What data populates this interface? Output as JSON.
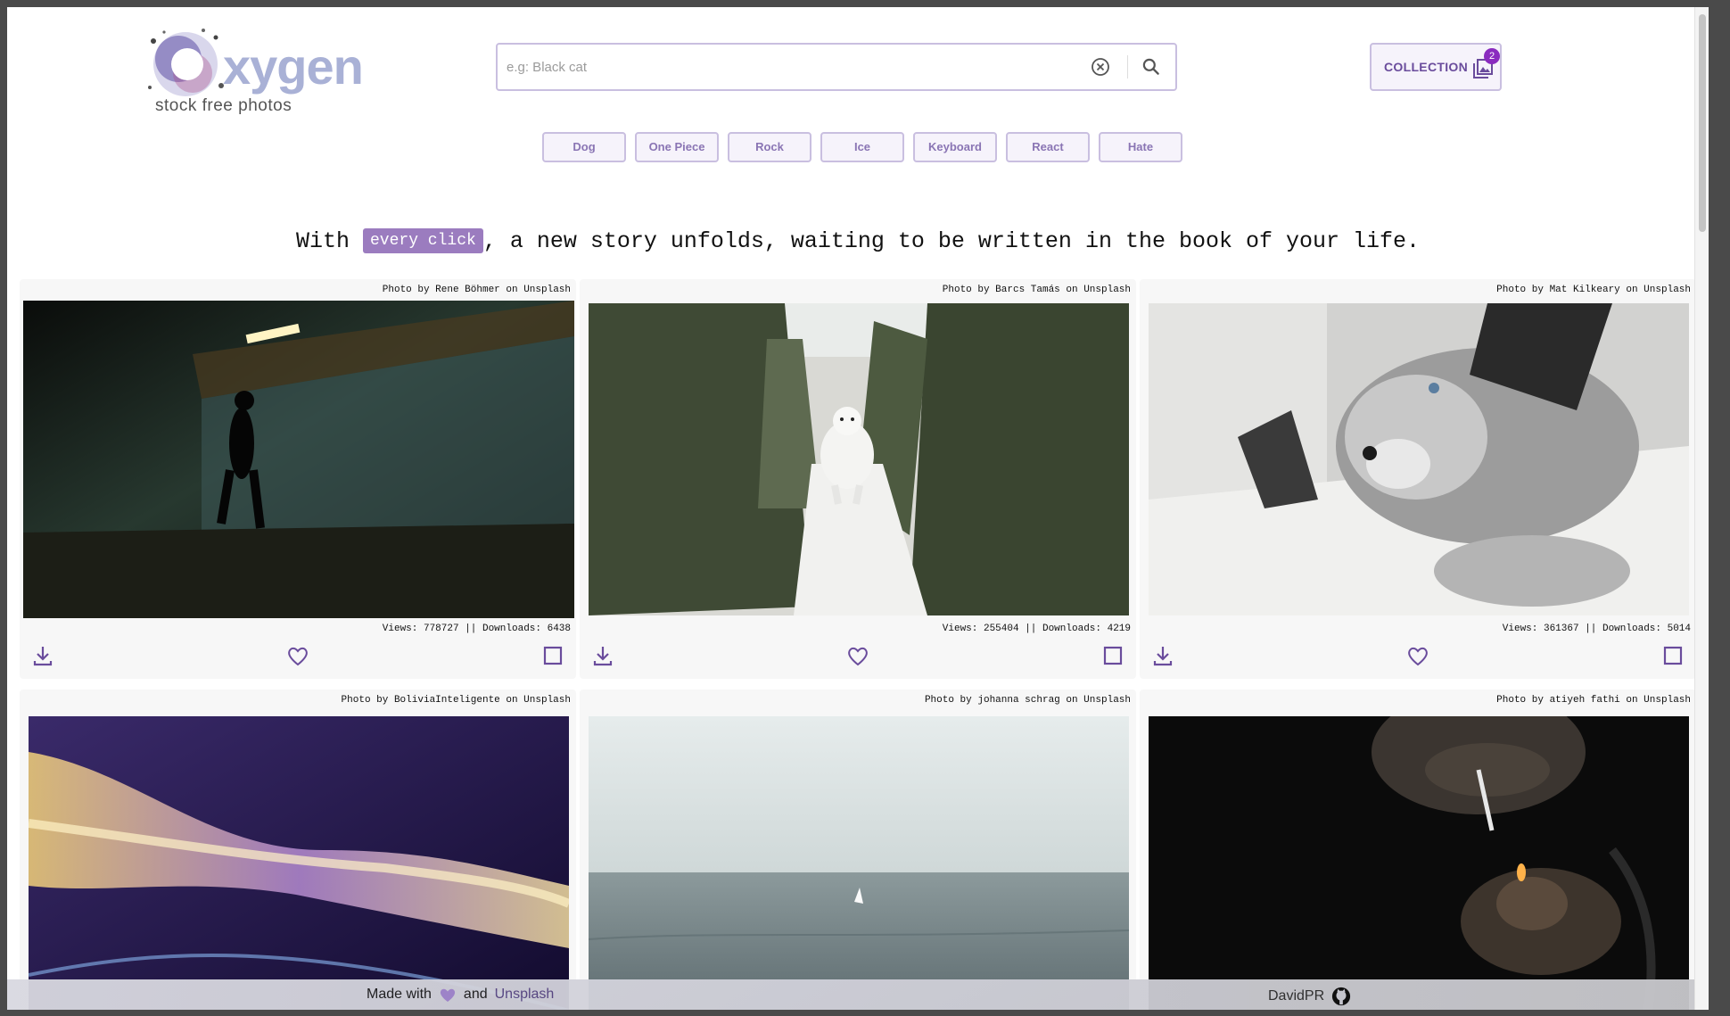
{
  "header": {
    "logo_word": "xygen",
    "logo_subtitle": "stock free photos",
    "search": {
      "placeholder": "e.g: Black cat",
      "value": "",
      "clear_icon": "clear-circle-icon",
      "search_icon": "search-icon"
    },
    "collection": {
      "label": "COLLECTION",
      "count": "2",
      "icon": "photo-library-icon"
    }
  },
  "tags": [
    "Dog",
    "One Piece",
    "Rock",
    "Ice",
    "Keyboard",
    "React",
    "Hate"
  ],
  "tagline": {
    "before": "With ",
    "highlight": "every click",
    "after": ", a new story unfolds, waiting to be written in the book of your life."
  },
  "photos": [
    {
      "credit": "Photo by Rene Böhmer on Unsplash",
      "stats": "Views: 778727 || Downloads: 6438"
    },
    {
      "credit": "Photo by Barcs Tamás on Unsplash",
      "stats": "Views: 255404 || Downloads: 4219"
    },
    {
      "credit": "Photo by Mat Kilkeary on Unsplash",
      "stats": "Views: 361367 || Downloads: 5014"
    },
    {
      "credit": "Photo by BoliviaInteligente on Unsplash"
    },
    {
      "credit": "Photo by johanna schrag on Unsplash"
    },
    {
      "credit": "Photo by atiyeh fathi on Unsplash"
    }
  ],
  "footer": {
    "made_with": "Made with",
    "and": "and",
    "unsplash": "Unsplash",
    "author": "DavidPR",
    "heart_icon": "heart-icon",
    "github_icon": "github-icon"
  },
  "colors": {
    "accent": "#9b7cbf",
    "accent_dark": "#6a4c9c",
    "border": "#c9bfe0"
  }
}
